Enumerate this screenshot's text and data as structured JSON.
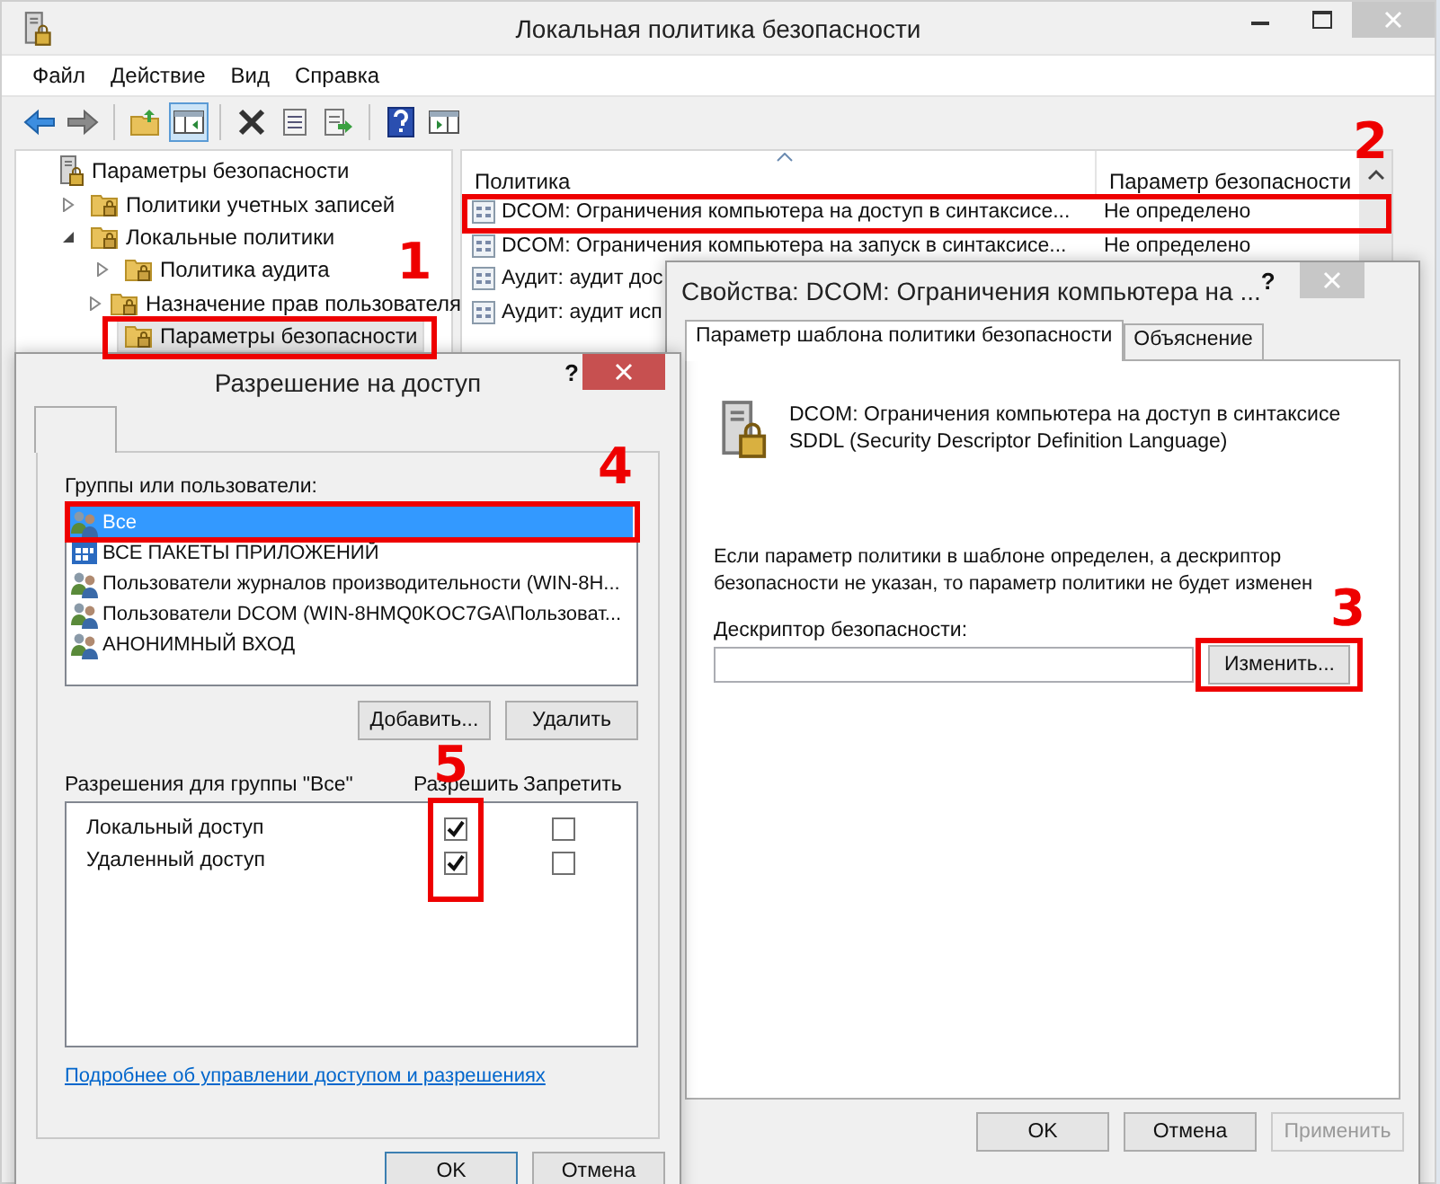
{
  "main_window": {
    "title": "Локальная политика безопасности",
    "menu": [
      "Файл",
      "Действие",
      "Вид",
      "Справка"
    ],
    "toolbar": [
      [
        {
          "kind": "back",
          "pressed": false
        },
        {
          "kind": "forward",
          "pressed": false
        }
      ],
      [
        {
          "kind": "up",
          "pressed": false
        },
        {
          "kind": "tree",
          "pressed": true
        }
      ],
      [
        {
          "kind": "delete",
          "pressed": false
        },
        {
          "kind": "properties",
          "pressed": false
        },
        {
          "kind": "export",
          "pressed": false
        }
      ],
      [
        {
          "kind": "help",
          "pressed": false
        },
        {
          "kind": "pane",
          "pressed": false
        }
      ]
    ],
    "tree": [
      {
        "label": "Параметры безопасности",
        "kind": "root",
        "selected": false,
        "children": [
          {
            "label": "Политики учетных записей",
            "kind": "folder",
            "expanded": false,
            "selected": false
          },
          {
            "label": "Локальные политики",
            "kind": "folder",
            "expanded": true,
            "selected": false,
            "children": [
              {
                "label": "Политика аудита",
                "kind": "folder",
                "expanded": false,
                "selected": false
              },
              {
                "label": "Назначение прав пользователя",
                "kind": "folder",
                "expanded": false,
                "selected": false
              },
              {
                "label": "Параметры безопасности",
                "kind": "folder",
                "selected": true,
                "callout": "1"
              }
            ]
          }
        ]
      }
    ],
    "columns": [
      {
        "label": "Политика",
        "sorted": true
      },
      {
        "label": "Параметр безопасности",
        "sorted": false
      }
    ],
    "rows": [
      {
        "policy": "DCOM: Ограничения компьютера на доступ в синтаксисе...",
        "setting": "Не определено",
        "callout": "2"
      },
      {
        "policy": "DCOM: Ограничения компьютера на запуск в синтаксисе...",
        "setting": "Не определено"
      },
      {
        "policy": "Аудит: аудит дос"
      },
      {
        "policy": "Аудит: аудит исп"
      }
    ]
  },
  "properties_dialog": {
    "title": "Свойства: DCOM: Ограничения компьютера на ...",
    "help_button": "?",
    "tabs": [
      {
        "label": "Параметр шаблона политики безопасности",
        "selected": true
      },
      {
        "label": "Объяснение",
        "selected": false
      }
    ],
    "policy_name": "DCOM: Ограничения компьютера на доступ в синтаксисе SDDL (Security Descriptor Definition Language)",
    "note": "Если параметр политики в шаблоне определен, а дескриптор безопасности не указан, то параметр политики не будет изменен",
    "descriptor_label": "Дескриптор безопасности:",
    "change_button": {
      "label": "Изменить...",
      "callout": "3"
    },
    "buttons": [
      {
        "label": "OK",
        "disabled": false
      },
      {
        "label": "Отмена",
        "disabled": false
      },
      {
        "label": "Применить",
        "disabled": true
      }
    ]
  },
  "access_dialog": {
    "title": "Разрешение на доступ",
    "help_button": "?",
    "groups_label": "Группы или пользователи:",
    "groups": [
      {
        "name": "Все",
        "kind": "users",
        "selected": true,
        "callout": "4"
      },
      {
        "name": "ВСЕ ПАКЕТЫ ПРИЛОЖЕНИЙ",
        "kind": "package",
        "selected": false
      },
      {
        "name": "Пользователи журналов производительности (WIN-8H...",
        "kind": "users",
        "selected": false
      },
      {
        "name": "Пользователи DCOM (WIN-8HMQ0KOC7GA\\Пользоват...",
        "kind": "users",
        "selected": false
      },
      {
        "name": "АНОНИМНЫЙ ВХОД",
        "kind": "users",
        "selected": false
      }
    ],
    "group_buttons": [
      "Добавить...",
      "Удалить"
    ],
    "permissions_label": "Разрешения для группы \"Все\"",
    "allow_header": "Разрешить",
    "deny_header": "Запретить",
    "allow_callout": "5",
    "permissions": [
      {
        "name": "Локальный доступ",
        "allow": true,
        "deny": false
      },
      {
        "name": "Удаленный доступ",
        "allow": true,
        "deny": false
      }
    ],
    "link": "Подробнее об управлении доступом и разрешениях",
    "buttons": [
      {
        "label": "OK",
        "default": true
      },
      {
        "label": "Отмена",
        "default": false
      }
    ]
  }
}
